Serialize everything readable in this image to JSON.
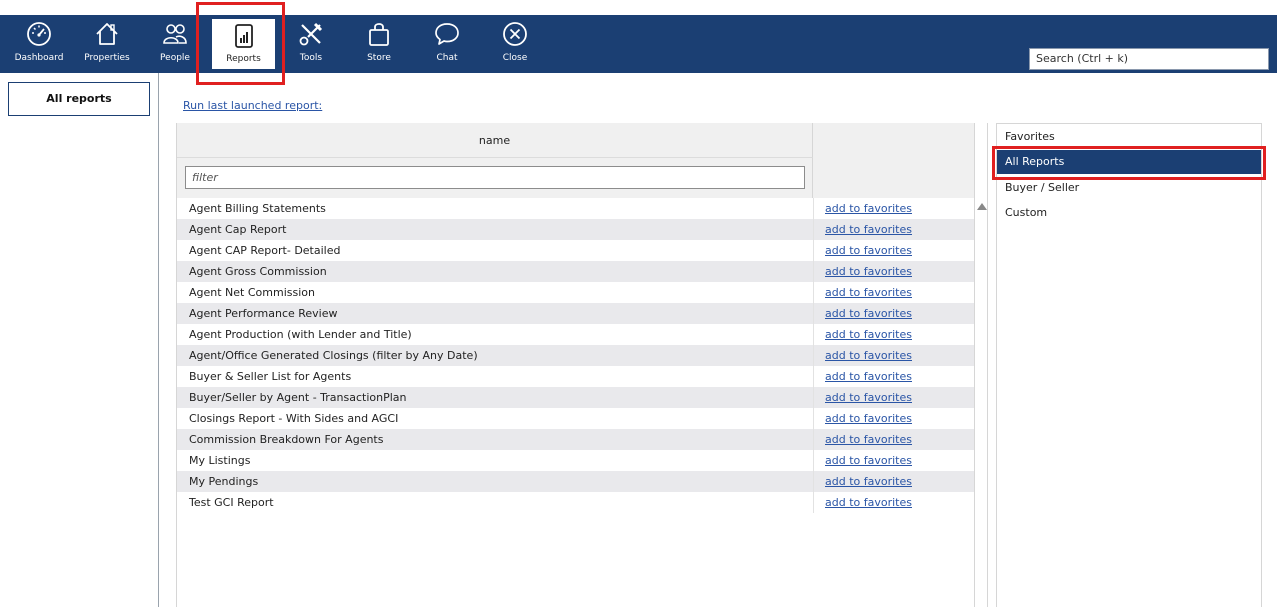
{
  "nav": {
    "items": [
      {
        "label": "Dashboard",
        "icon": "dashboard-icon"
      },
      {
        "label": "Properties",
        "icon": "house-icon"
      },
      {
        "label": "People",
        "icon": "people-icon"
      },
      {
        "label": "Reports",
        "icon": "reports-icon",
        "active": true
      },
      {
        "label": "Tools",
        "icon": "tools-icon"
      },
      {
        "label": "Store",
        "icon": "bag-icon"
      },
      {
        "label": "Chat",
        "icon": "chat-icon"
      },
      {
        "label": "Close",
        "icon": "close-icon"
      }
    ],
    "search_placeholder": "Search (Ctrl + k)"
  },
  "sidebar": {
    "all_reports_label": "All reports"
  },
  "main": {
    "run_last_label": "Run last launched report:",
    "table": {
      "name_header": "name",
      "filter_placeholder": "filter",
      "rows": [
        {
          "name": "Agent Billing Statements",
          "action": "add to favorites"
        },
        {
          "name": "Agent Cap Report",
          "action": "add to favorites"
        },
        {
          "name": "Agent CAP Report- Detailed",
          "action": "add to favorites"
        },
        {
          "name": "Agent Gross Commission",
          "action": "add to favorites"
        },
        {
          "name": "Agent Net Commission",
          "action": "add to favorites"
        },
        {
          "name": "Agent Performance Review",
          "action": "add to favorites"
        },
        {
          "name": "Agent Production (with Lender and Title)",
          "action": "add to favorites"
        },
        {
          "name": "Agent/Office Generated Closings (filter by Any Date)",
          "action": "add to favorites"
        },
        {
          "name": "Buyer & Seller List for Agents",
          "action": "add to favorites"
        },
        {
          "name": "Buyer/Seller by Agent - TransactionPlan",
          "action": "add to favorites"
        },
        {
          "name": "Closings Report - With Sides and AGCI",
          "action": "add to favorites"
        },
        {
          "name": "Commission Breakdown For Agents",
          "action": "add to favorites"
        },
        {
          "name": "My Listings",
          "action": "add to favorites"
        },
        {
          "name": "My Pendings",
          "action": "add to favorites"
        },
        {
          "name": "Test GCI Report",
          "action": "add to favorites"
        }
      ]
    }
  },
  "categories": [
    {
      "label": "Favorites"
    },
    {
      "label": "All Reports",
      "selected": true
    },
    {
      "label": "Buyer / Seller"
    },
    {
      "label": "Custom"
    }
  ],
  "colors": {
    "navbar": "#1b3f73",
    "highlight": "#e02020",
    "link": "#2a55a6",
    "row_alt": "#e9e9ec"
  }
}
